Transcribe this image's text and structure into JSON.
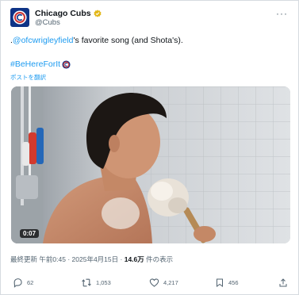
{
  "account": {
    "name": "Chicago Cubs",
    "handle": "@Cubs",
    "verified_color": "#e2b719",
    "avatar_color": "#0e3386"
  },
  "post": {
    "text_lead": ".",
    "text_link": "@ofcwrigleyfield",
    "text_rest": "'s favorite song (and Shota's).",
    "hashtag": "#BeHereForIt",
    "translate_label": "ポストを翻訳",
    "video_duration": "0:07"
  },
  "meta": {
    "updated_label": "最終更新",
    "time": "午前0:45",
    "separator": "·",
    "date": "2025年4月15日",
    "views_count": "14.6万",
    "views_label": "件の表示"
  },
  "actions": {
    "replies": "62",
    "reposts": "1,053",
    "likes": "4,217",
    "bookmarks": "456"
  },
  "colors": {
    "link": "#1d9bf0",
    "muted": "#536471",
    "text": "#0f1419"
  }
}
